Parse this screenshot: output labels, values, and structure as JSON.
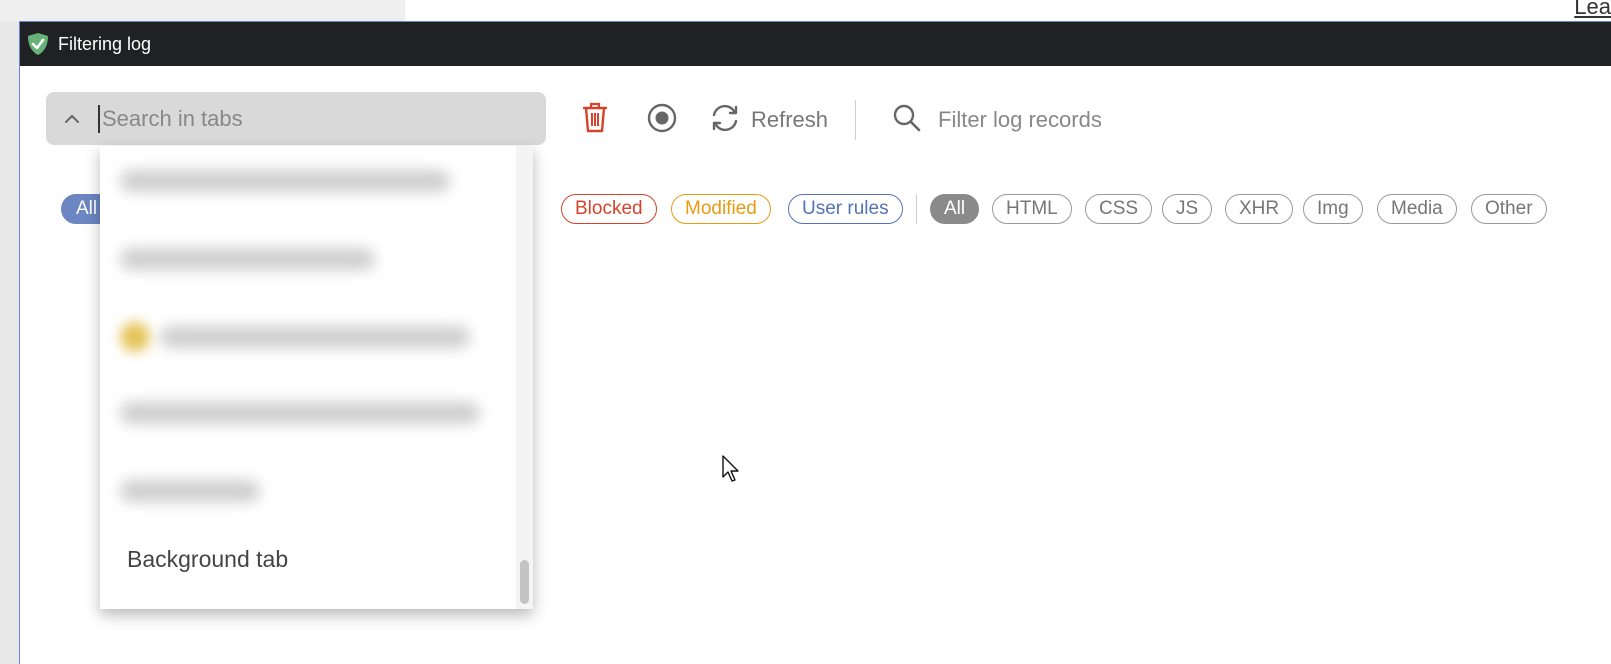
{
  "background": {
    "link_text": "Lea"
  },
  "window": {
    "title": "Filtering log"
  },
  "toolbar": {
    "search_placeholder": "Search in tabs",
    "refresh_label": "Refresh",
    "filter_placeholder": "Filter log records"
  },
  "status_filters": [
    {
      "label": "All",
      "selected": true
    },
    {
      "label": "Blocked",
      "color": "#d5432b"
    },
    {
      "label": "Modified",
      "color": "#e79b12"
    },
    {
      "label": "User rules",
      "color": "#5573b5"
    }
  ],
  "type_filters": [
    {
      "label": "All",
      "selected": true
    },
    {
      "label": "HTML"
    },
    {
      "label": "CSS"
    },
    {
      "label": "JS"
    },
    {
      "label": "XHR"
    },
    {
      "label": "Img"
    },
    {
      "label": "Media"
    },
    {
      "label": "Other"
    }
  ],
  "dropdown": {
    "visible_item": "Background tab"
  },
  "colors": {
    "titlebar": "#202124",
    "accent_green": "#67b279",
    "trash_red": "#d5432b"
  }
}
